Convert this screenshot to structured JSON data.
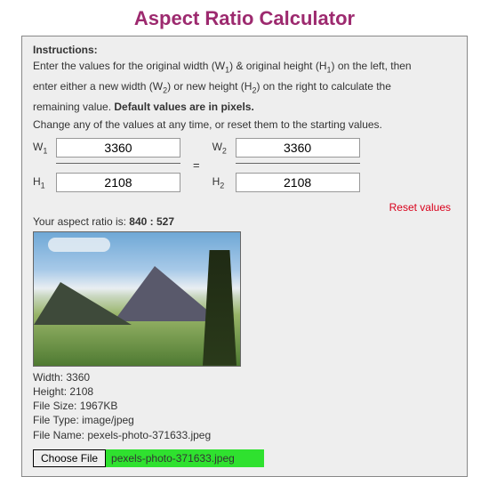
{
  "title": "Aspect Ratio Calculator",
  "instructions": {
    "heading": "Instructions:",
    "line1a": "Enter the values for the original width (W",
    "line1b": ") & original height (H",
    "line1c": ") on the left, then",
    "line2a": "enter either a new width (W",
    "line2b": ") or new height (H",
    "line2c": ") on the right to calculate the",
    "line3a": "remaining value. ",
    "line3b": "Default values are in pixels.",
    "line4": "Change any of the values at any time, or reset them to the starting values."
  },
  "labels": {
    "w1": "W",
    "h1": "H",
    "w2": "W",
    "h2": "H",
    "sub1": "1",
    "sub2": "2",
    "equals": "="
  },
  "values": {
    "w1": "3360",
    "h1": "2108",
    "w2": "3360",
    "h2": "2108"
  },
  "reset": "Reset values",
  "ratio": {
    "prefix": "Your aspect ratio is: ",
    "value": "840 : 527"
  },
  "meta": {
    "width_label": "Width: ",
    "width": "3360",
    "height_label": "Height: ",
    "height": "2108",
    "size_label": "File Size: ",
    "size": "1967KB",
    "type_label": "File Type: ",
    "type": "image/jpeg",
    "name_label": "File Name: ",
    "name": "pexels-photo-371633.jpeg"
  },
  "file": {
    "choose": "Choose File",
    "selected": "pexels-photo-371633.jpeg"
  }
}
